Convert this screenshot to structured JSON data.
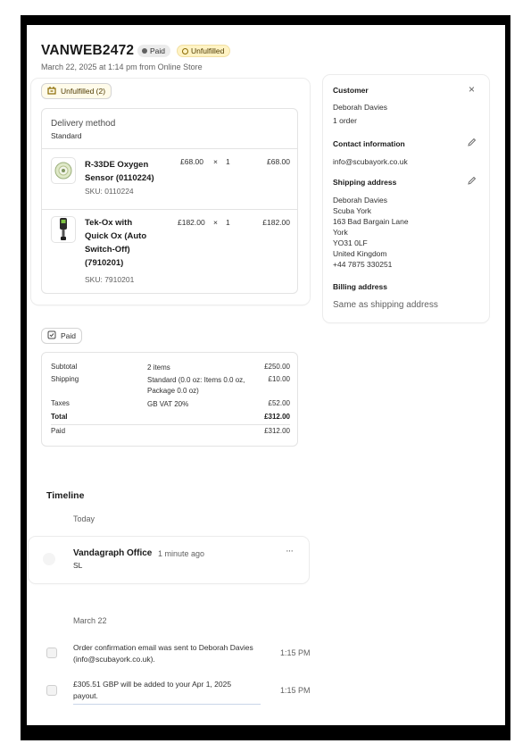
{
  "order": {
    "number": "VANWEB2472",
    "payment_badge": "Paid",
    "fulfillment_badge": "Unfulfilled",
    "date_line": "March 22, 2025 at 1:14 pm from Online Store"
  },
  "fulfillment": {
    "status_label": "Unfulfilled (2)",
    "delivery_method_label": "Delivery method",
    "delivery_method_value": "Standard",
    "items": [
      {
        "name_lines": [
          "R-33DE Oxygen",
          "Sensor (0110224)"
        ],
        "sku": "SKU: 0110224",
        "price": "£68.00",
        "times": "×",
        "qty": "1",
        "total": "£68.00",
        "icon": "oxygen-sensor-image"
      },
      {
        "name_lines": [
          "Tek-Ox with",
          "Quick Ox (Auto",
          "Switch-Off)",
          "(7910201)"
        ],
        "sku": "SKU: 7910201",
        "price": "£182.00",
        "times": "×",
        "qty": "1",
        "total": "£182.00",
        "icon": "tek-ox-analyser-image"
      }
    ]
  },
  "payment": {
    "status_label": "Paid",
    "rows": [
      {
        "label": "Subtotal",
        "detail": "2 items",
        "amount": "£250.00"
      },
      {
        "label": "Shipping",
        "detail": "Standard (0.0 oz: Items 0.0 oz, Package 0.0 oz)",
        "amount": "£10.00"
      },
      {
        "label": "Taxes",
        "detail": "GB VAT 20%",
        "amount": "£52.00"
      },
      {
        "label": "Total",
        "detail": "",
        "amount": "£312.00"
      },
      {
        "label": "Paid",
        "detail": "",
        "amount": "£312.00"
      }
    ]
  },
  "customer": {
    "heading": "Customer",
    "name": "Deborah Davies",
    "orders": "1 order",
    "contact_heading": "Contact information",
    "email": "info@scubayork.co.uk",
    "shipping_heading": "Shipping address",
    "shipping_lines": [
      "Deborah Davies",
      "Scuba York",
      "163 Bad Bargain Lane",
      "York",
      "YO31 0LF",
      "United Kingdom",
      "+44 7875 330251"
    ],
    "billing_heading": "Billing address",
    "billing_value": "Same as shipping address"
  },
  "timeline": {
    "heading": "Timeline",
    "today_label": "Today",
    "comment_author": "Vandagraph Office",
    "comment_time": "1 minute ago",
    "comment_text": "SL",
    "more_glyph": "···",
    "date_label": "March 22",
    "events": [
      {
        "text_lines": [
          "Order confirmation email was sent to Deborah Davies",
          "(info@scubayork.co.uk)."
        ],
        "time": "1:15 PM"
      },
      {
        "text_lines": [
          "£305.51 GBP will be added to your Apr 1, 2025",
          "payout."
        ],
        "time": "1:15 PM"
      }
    ]
  },
  "colors": {
    "unfulfilled_bg": "#fff3c4",
    "paid_bg": "#ebebeb",
    "text": "#303030",
    "muted": "#616161"
  }
}
